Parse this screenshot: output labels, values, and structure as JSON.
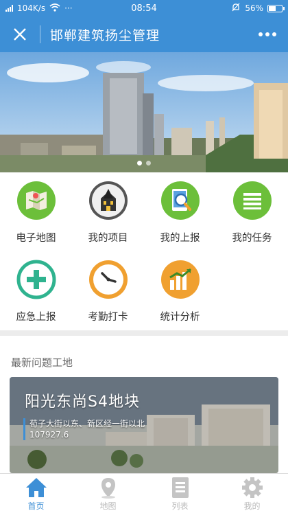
{
  "status_bar": {
    "speed": "104K/s",
    "time": "08:54",
    "battery": "56%",
    "battery_level": 0.56,
    "more": "···"
  },
  "header": {
    "title": "邯郸建筑扬尘管理"
  },
  "banner": {
    "slide_count": 2,
    "active_slide": 0
  },
  "menu": {
    "items": [
      {
        "label": "电子地图",
        "icon": "map-icon"
      },
      {
        "label": "我的项目",
        "icon": "building-icon"
      },
      {
        "label": "我的上报",
        "icon": "search-report-icon"
      },
      {
        "label": "我的任务",
        "icon": "list-icon"
      },
      {
        "label": "应急上报",
        "icon": "plus-icon"
      },
      {
        "label": "考勤打卡",
        "icon": "clock-icon"
      },
      {
        "label": "统计分析",
        "icon": "chart-icon"
      }
    ]
  },
  "section": {
    "title": "最新问题工地",
    "card": {
      "name": "阳光东尚S4地块",
      "address": "荀子大街以东、新区经一街以北",
      "code": "107927.6"
    }
  },
  "tabbar": {
    "items": [
      {
        "label": "首页",
        "icon": "home-icon",
        "active": true
      },
      {
        "label": "地图",
        "icon": "location-pin-icon",
        "active": false
      },
      {
        "label": "列表",
        "icon": "list-doc-icon",
        "active": false
      },
      {
        "label": "我的",
        "icon": "gear-icon",
        "active": false
      }
    ]
  },
  "colors": {
    "primary": "#3d8fd6",
    "green": "#6cbf3a",
    "teal": "#2fb38f",
    "orange": "#f0a030"
  }
}
